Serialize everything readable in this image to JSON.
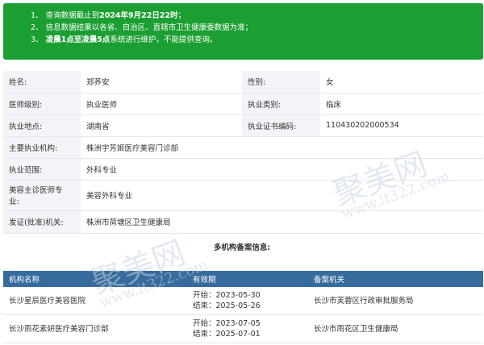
{
  "notice": {
    "line1": {
      "prefix": "1、 查询数据截止到",
      "bold": "2024年9月22日22时",
      "suffix": "；"
    },
    "line2": {
      "text": "2、 信息数据结果以各省、自治区、直辖市卫生健康委数据为准；"
    },
    "line3": {
      "prefix": "3、 ",
      "bold": "凌晨1点至凌晨5点",
      "suffix": "系统进行维护，不能提供查询。"
    }
  },
  "info": {
    "name_label": "姓名:",
    "name_value": "郑荞安",
    "gender_label": "性别:",
    "gender_value": "女",
    "level_label": "医师级别:",
    "level_value": "执业医师",
    "category_label": "执业类别:",
    "category_value": "临床",
    "location_label": "执业地点:",
    "location_value": "湖南省",
    "cert_label": "执业证书编码:",
    "cert_value": "110430202000534",
    "org_label": "主要执业机构:",
    "org_value": "株洲宇芳姬医疗美容门诊部",
    "scope_label": "执业范围:",
    "scope_value": "外科专业",
    "beauty_label_1": "美容主诊医师专",
    "beauty_label_2": "业:",
    "beauty_value": "美容外科专业",
    "issuer_label": "发证(批准)机关:",
    "issuer_value": "株洲市荷塘区卫生健康局"
  },
  "multi": {
    "title": "多机构备案信息:",
    "headers": [
      "机构名称",
      "有效期",
      "备案机关"
    ],
    "rows": [
      {
        "name": "长沙星辰医疗美容医院",
        "start": "开始：2023-05-30",
        "end": "结束：2025-05-26",
        "agency": "长沙市芙蓉区行政审批服务局"
      },
      {
        "name": "长沙雨花素妍医疗美容门诊部",
        "start": "开始：2023-07-05",
        "end": "结束：2025-07-01",
        "agency": "长沙市雨花区卫生健康局"
      }
    ]
  },
  "watermark": {
    "brand": "聚美网",
    "url": "www.it322.com"
  }
}
